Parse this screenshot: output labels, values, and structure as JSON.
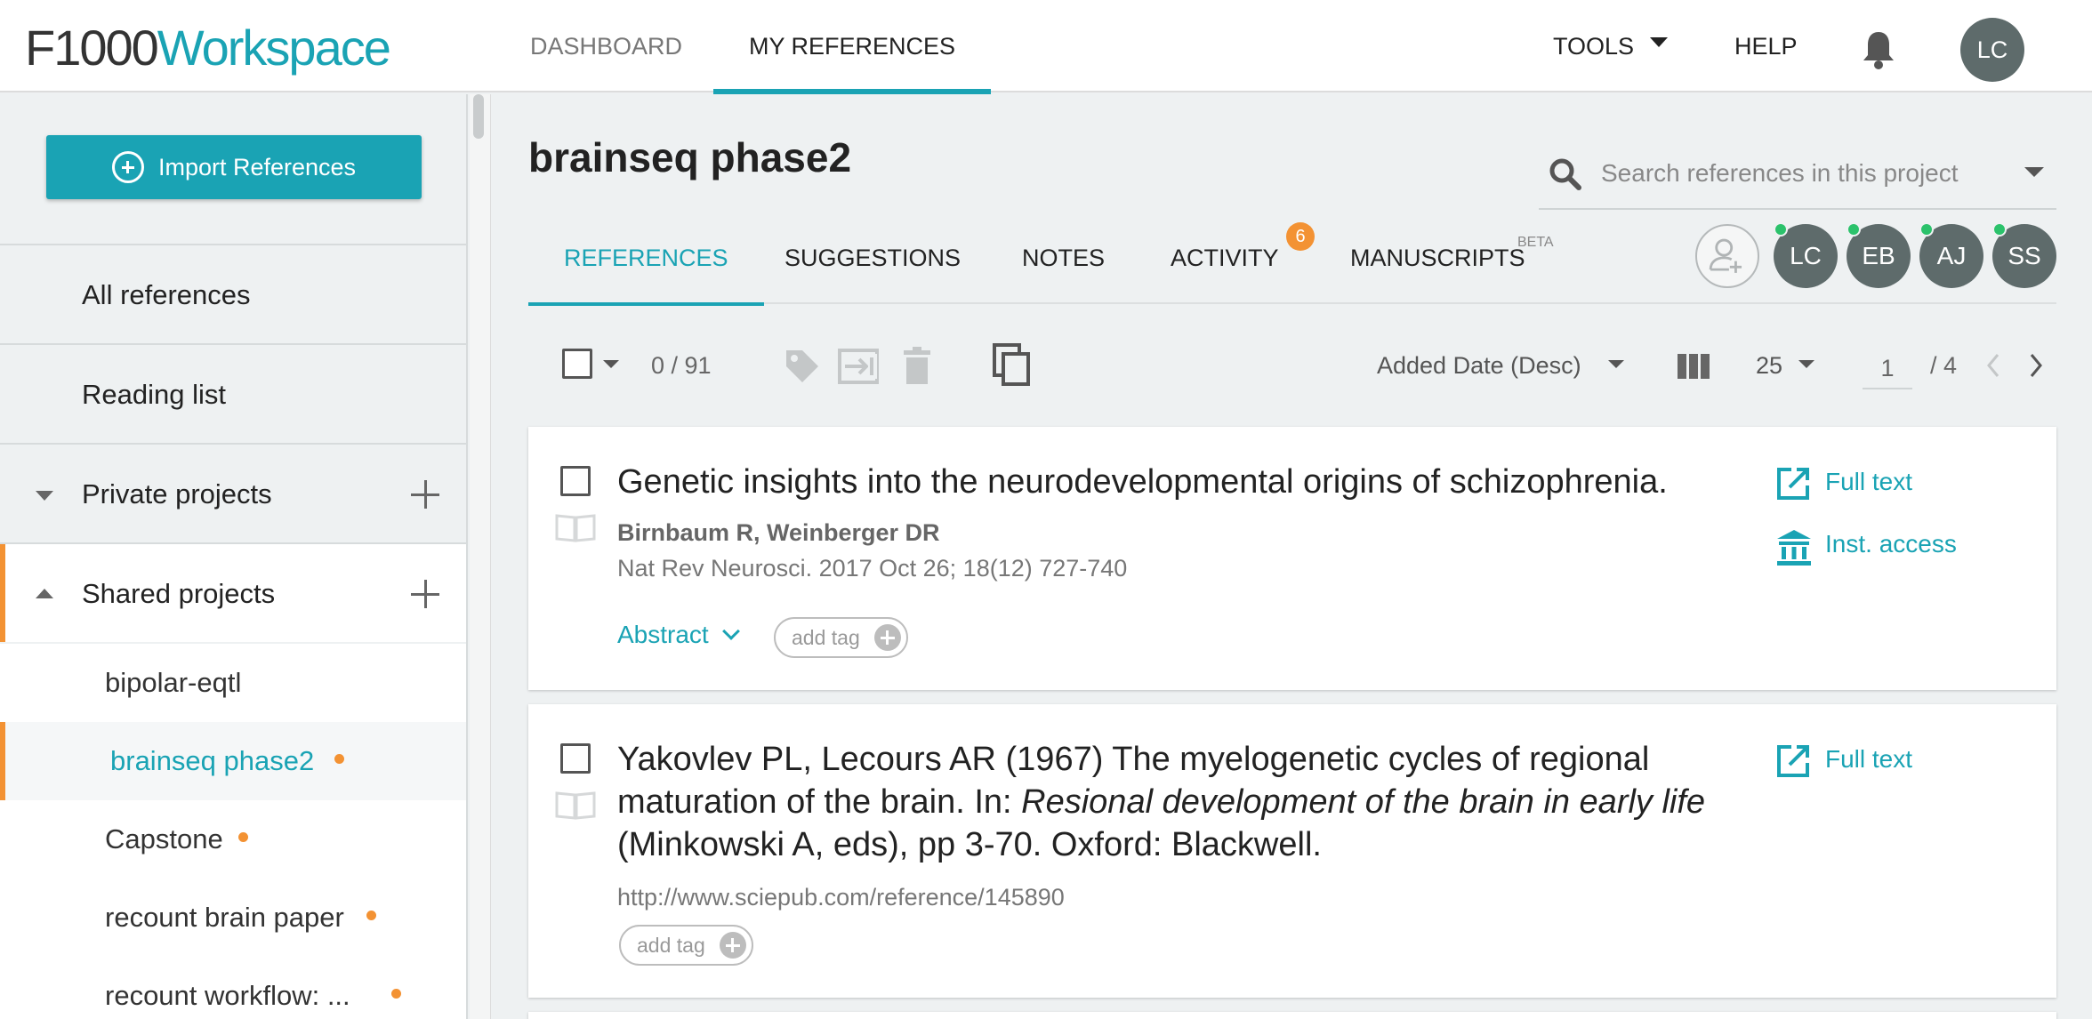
{
  "app": {
    "logo_part1": "F1000",
    "logo_part2": "Workspace",
    "nav_tabs": [
      "DASHBOARD",
      "MY REFERENCES"
    ],
    "tools_label": "TOOLS",
    "help_label": "HELP",
    "user_initials": "LC",
    "accent_color": "#1aa3b4",
    "highlight_color": "#f39233"
  },
  "sidebar": {
    "import_label": "Import References",
    "all_references": "All references",
    "reading_list": "Reading list",
    "private_projects": "Private projects",
    "shared_projects": "Shared projects",
    "projects": [
      {
        "label": "bipolar-eqtl",
        "has_update": false
      },
      {
        "label": "brainseq phase2",
        "has_update": true
      },
      {
        "label": "Capstone",
        "has_update": true
      },
      {
        "label": "recount brain paper",
        "has_update": true
      },
      {
        "label": "recount workflow: ...",
        "has_update": true
      }
    ]
  },
  "project": {
    "title": "brainseq phase2",
    "search_placeholder": "Search references in this project",
    "tabs": [
      "REFERENCES",
      "SUGGESTIONS",
      "NOTES",
      "ACTIVITY",
      "MANUSCRIPTS"
    ],
    "activity_badge": "6",
    "manuscripts_badge": "BETA",
    "members": [
      "LC",
      "EB",
      "AJ",
      "SS"
    ]
  },
  "toolbar": {
    "selection_count": "0 / 91",
    "sort_label": "Added Date (Desc)",
    "page_size": "25",
    "current_page": "1",
    "total_pages": "/ 4"
  },
  "references": [
    {
      "title": "Genetic insights into the neurodevelopmental origins of schizophrenia.",
      "authors": "Birnbaum R, Weinberger DR",
      "journal": "Nat Rev Neurosci. 2017 Oct 26; 18(12) 727-740",
      "abstract_label": "Abstract",
      "tag_label": "add tag",
      "links": [
        "Full text",
        "Inst. access"
      ]
    },
    {
      "title_part1": "Yakovlev PL, Lecours AR (1967) The myelogenetic cycles of regional maturation of the brain. In: ",
      "title_italic": "Resional development of the brain in early life",
      "title_part2": " (Minkowski A, eds), pp 3-70. Oxford: Blackwell.",
      "url": "http://www.sciepub.com/reference/145890",
      "tag_label": "add tag",
      "links": [
        "Full text"
      ]
    }
  ]
}
